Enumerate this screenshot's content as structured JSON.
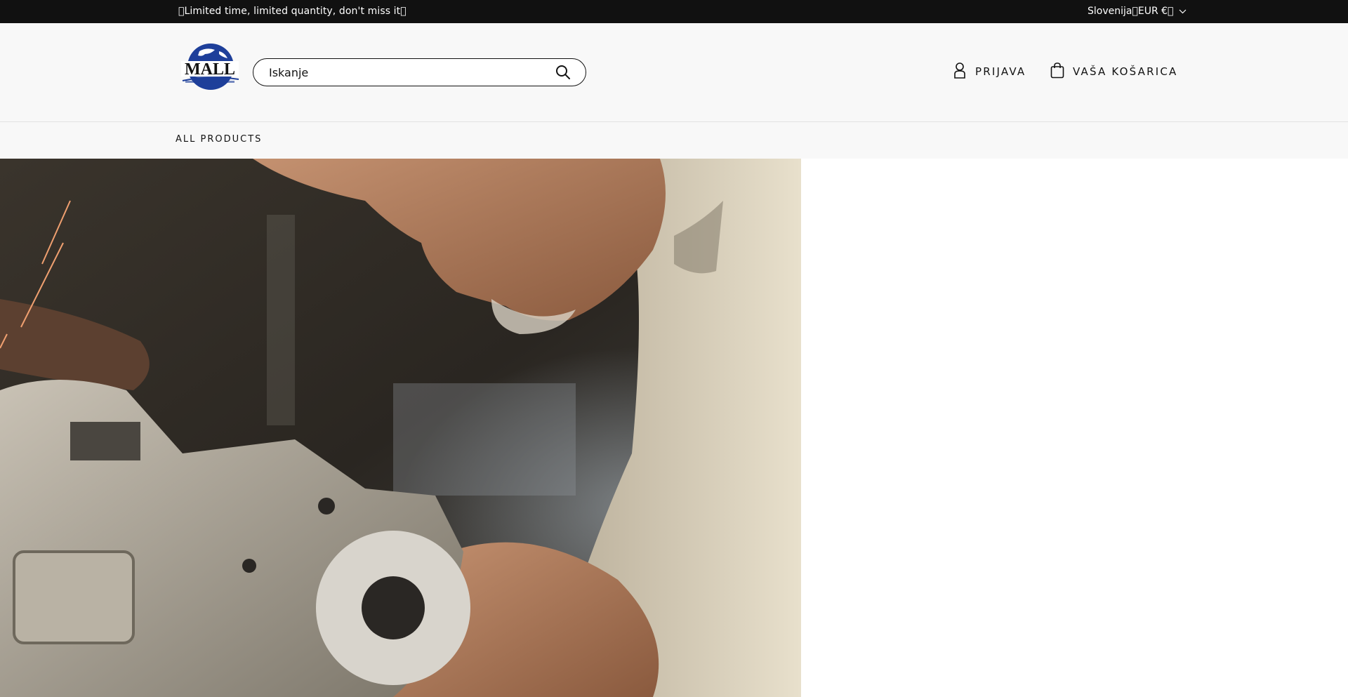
{
  "announcement": {
    "text": "\u0000Limited time, limited quantity, don't miss it\u0000",
    "locale": "Slovenija\u0000EUR €\u0000"
  },
  "header": {
    "logo_text": "MALL",
    "search_placeholder": "Iskanje",
    "login_label": "PRIJAVA",
    "cart_label": "VAŠA KOŠARICA"
  },
  "nav": {
    "items": [
      {
        "label": "ALL PRODUCTS"
      }
    ]
  },
  "hero": {
    "image": "craftsman using grinder"
  },
  "colors": {
    "announcement_bg": "#111111",
    "header_bg": "#f8f8f8",
    "logo_blue": "#1e3f9a",
    "text": "#121212"
  },
  "icons": [
    "chevron-down-icon",
    "search-icon",
    "user-icon",
    "shopping-bag-icon"
  ]
}
